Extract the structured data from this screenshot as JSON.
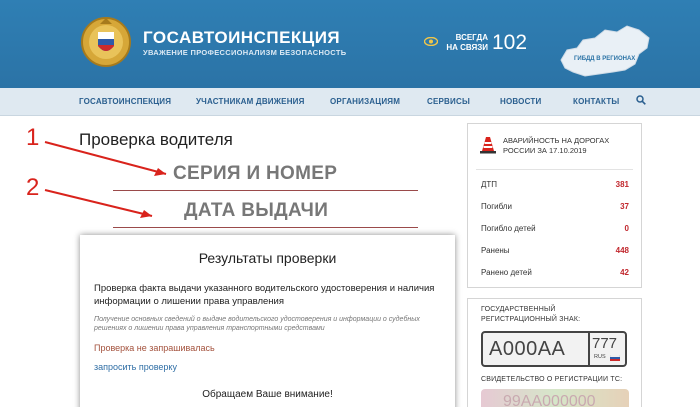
{
  "header": {
    "brand_title": "ГОСАВТОИНСПЕКЦИЯ",
    "brand_subtitle": "УВАЖЕНИЕ ПРОФЕССИОНАЛИЗМ БЕЗОПАСНОСТЬ",
    "always_line1": "ВСЕГДА",
    "always_line2": "НА СВЯЗИ",
    "phone": "102",
    "regions_label": "ГИБДД В РЕГИОНАХ"
  },
  "nav": {
    "items": [
      "ГОСАВТОИНСПЕКЦИЯ",
      "УЧАСТНИКАМ ДВИЖЕНИЯ",
      "ОРГАНИЗАЦИЯМ",
      "СЕРВИСЫ",
      "НОВОСТИ",
      "КОНТАКТЫ"
    ]
  },
  "main": {
    "title": "Проверка водителя",
    "marker1": "1",
    "marker2": "2",
    "field1": "СЕРИЯ И НОМЕР",
    "field2": "ДАТА ВЫДАЧИ"
  },
  "results": {
    "title": "Результаты проверки",
    "description": "Проверка факта выдачи указанного водительского удостоверения и наличия информации о лишении права управления",
    "note": "Получение основных сведений о выдаче водительского удостоверения и информации о судебных решениях о лишении права управления транспортными средствами",
    "status": "Проверка не запрашивалась",
    "link": "запросить проверку",
    "attention": "Обращаем Ваше внимание!"
  },
  "sidebar": {
    "heading": "АВАРИЙНОСТЬ НА ДОРОГАХ РОССИИ ЗА 17.10.2019",
    "stats": [
      {
        "label": "ДТП",
        "value": "381"
      },
      {
        "label": "Погибли",
        "value": "37"
      },
      {
        "label": "Погибло детей",
        "value": "0"
      },
      {
        "label": "Ранены",
        "value": "448"
      },
      {
        "label": "Ранено детей",
        "value": "42"
      }
    ],
    "plate_heading": "ГОСУДАРСТВЕННЫЙ РЕГИСТРАЦИОННЫЙ ЗНАК:",
    "plate_number": "А000АА",
    "plate_region": "777",
    "plate_rus": "RUS",
    "cert_heading": "СВИДЕТЕЛЬСТВО О РЕГИСТРАЦИИ ТС:",
    "cert_number": "99АА000000"
  },
  "colors": {
    "header_blue": "#2b73a6",
    "nav_bg": "#dfe9f1",
    "accent_red": "#d9231c",
    "stat_red": "#c1272d",
    "link_blue": "#2f6ea5"
  },
  "icons": {
    "emblem": "gibdd-emblem-icon",
    "eye": "eye-icon",
    "map": "russia-map-icon",
    "search": "search-icon",
    "cone": "traffic-cone-icon",
    "flag": "russia-flag-icon"
  }
}
